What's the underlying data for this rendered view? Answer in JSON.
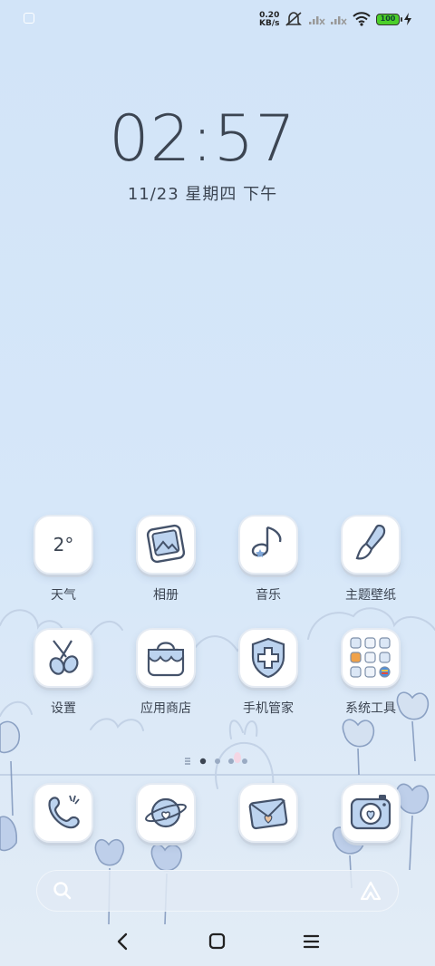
{
  "status_bar": {
    "speed_value": "0.20",
    "speed_unit": "KB/s",
    "battery_level": "100",
    "icons": [
      "screenshot-icon",
      "silent-mode-icon",
      "cellular-signal-no-service-icon",
      "cellular-signal-no-service-icon",
      "wifi-icon",
      "battery-icon",
      "charging-icon"
    ]
  },
  "lockclock": {
    "time": "02:57",
    "date": "11/23 星期四 下午"
  },
  "apps": [
    {
      "label": "天气",
      "icon": "weather-icon",
      "temp": "2°"
    },
    {
      "label": "相册",
      "icon": "gallery-icon"
    },
    {
      "label": "音乐",
      "icon": "music-icon"
    },
    {
      "label": "主题壁纸",
      "icon": "theme-brush-icon"
    },
    {
      "label": "设置",
      "icon": "settings-scissors-icon"
    },
    {
      "label": "应用商店",
      "icon": "app-store-bag-icon"
    },
    {
      "label": "手机管家",
      "icon": "security-shield-icon"
    },
    {
      "label": "系统工具",
      "icon": "system-tools-folder-icon"
    }
  ],
  "dock": [
    {
      "icon": "phone-icon"
    },
    {
      "icon": "browser-planet-icon"
    },
    {
      "icon": "messages-envelope-icon"
    },
    {
      "icon": "camera-icon"
    }
  ],
  "page_indicator": {
    "current": 1,
    "count": 4
  },
  "search_bar": {
    "left_icon": "search-icon",
    "right_icon": "assistant-icon"
  },
  "nav_bar": {
    "buttons": [
      "back-button",
      "home-button",
      "recents-button"
    ]
  }
}
